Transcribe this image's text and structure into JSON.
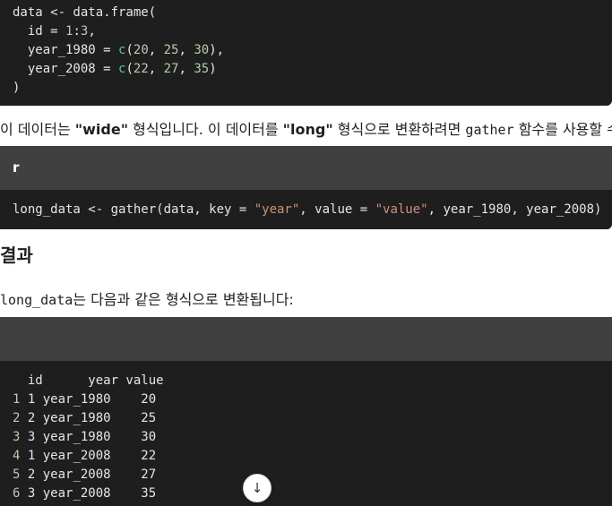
{
  "code1": {
    "lines": [
      "data <- data.frame(",
      "  id = 1:3,",
      "  year_1980 = c(20, 25, 30),",
      "  year_2008 = c(22, 27, 35)",
      ")"
    ]
  },
  "para1": {
    "t1": "이 데이터는 ",
    "b1": "\"wide\"",
    "t2": " 형식입니다. 이 데이터를 ",
    "b2": "\"long\"",
    "t3": " 형식으로 변환하려면 ",
    "code": "gather",
    "t4": " 함수를 사용할 수"
  },
  "code2": {
    "lang": "r",
    "line": {
      "a": "long_data <- gather(data, key = ",
      "s1": "\"year\"",
      "b": ", value = ",
      "s2": "\"value\"",
      "c": ", year_1980, year_2008)"
    }
  },
  "heading": "결과",
  "para2": {
    "code": "long_data",
    "text": "는 다음과 같은 형식으로 변환됩니다:"
  },
  "output": {
    "header": "  id      year value",
    "rows": [
      {
        "n": "1",
        "rest": " 1 year_1980    20"
      },
      {
        "n": "2",
        "rest": " 2 year_1980    25"
      },
      {
        "n": "3",
        "rest": " 3 year_1980    30"
      },
      {
        "n": "4",
        "rest": " 1 year_2008    22"
      },
      {
        "n": "5",
        "rest": " 2 year_2008    27"
      },
      {
        "n": "6",
        "rest": " 3 year_2008    35"
      }
    ]
  },
  "scroll_icon": "arrow-down-icon"
}
